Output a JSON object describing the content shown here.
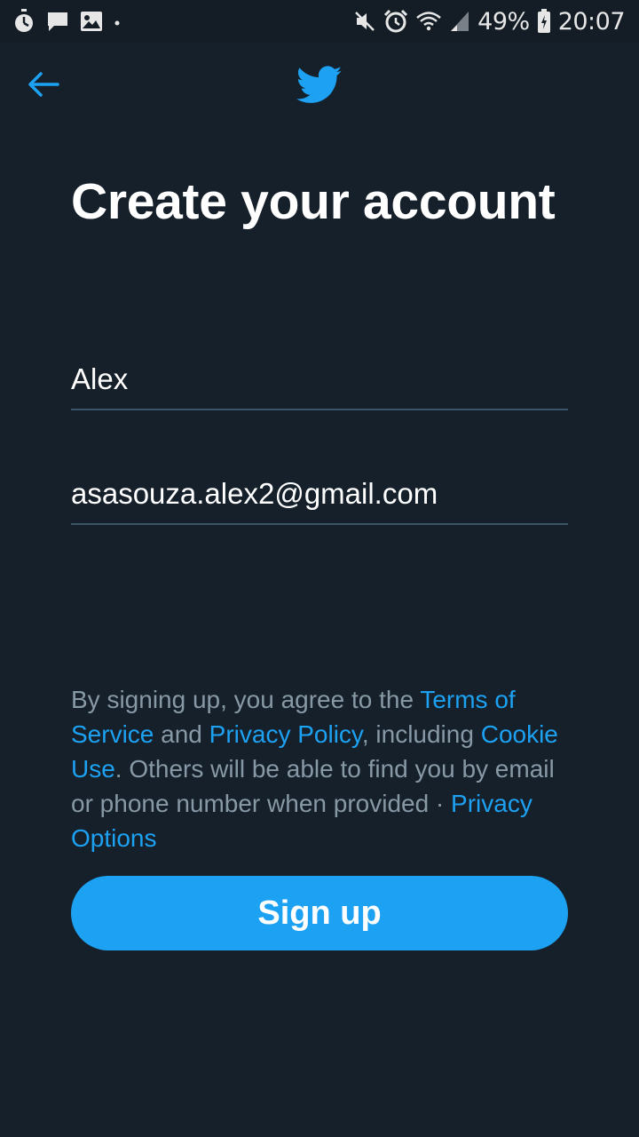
{
  "status_bar": {
    "battery": "49%",
    "time": "20:07",
    "left_icons": [
      "timer-icon",
      "message-icon",
      "image-icon",
      "dot-icon"
    ],
    "right_icons": [
      "mute-icon",
      "alarm-icon",
      "wifi-icon",
      "signal-icon",
      "battery-icon"
    ]
  },
  "header": {
    "back_icon": "arrow-left-icon",
    "logo_icon": "twitter-bird-icon"
  },
  "title": "Create your account",
  "form": {
    "name_value": "Alex",
    "email_value": "asasouza.alex2@gmail.com"
  },
  "terms": {
    "part1": "By signing up, you agree to the ",
    "terms_link": "Terms of Service",
    "part2": " and ",
    "privacy_link": "Privacy Policy",
    "part3": ", including ",
    "cookie_link": "Cookie Use",
    "part4": ". Others will be able to find you by email or phone number when provided · ",
    "options_link": "Privacy Options"
  },
  "signup_label": "Sign up",
  "colors": {
    "background": "#15202b",
    "accent": "#1da1f2",
    "secondary_text": "#8899a6",
    "divider": "#3d5466"
  }
}
